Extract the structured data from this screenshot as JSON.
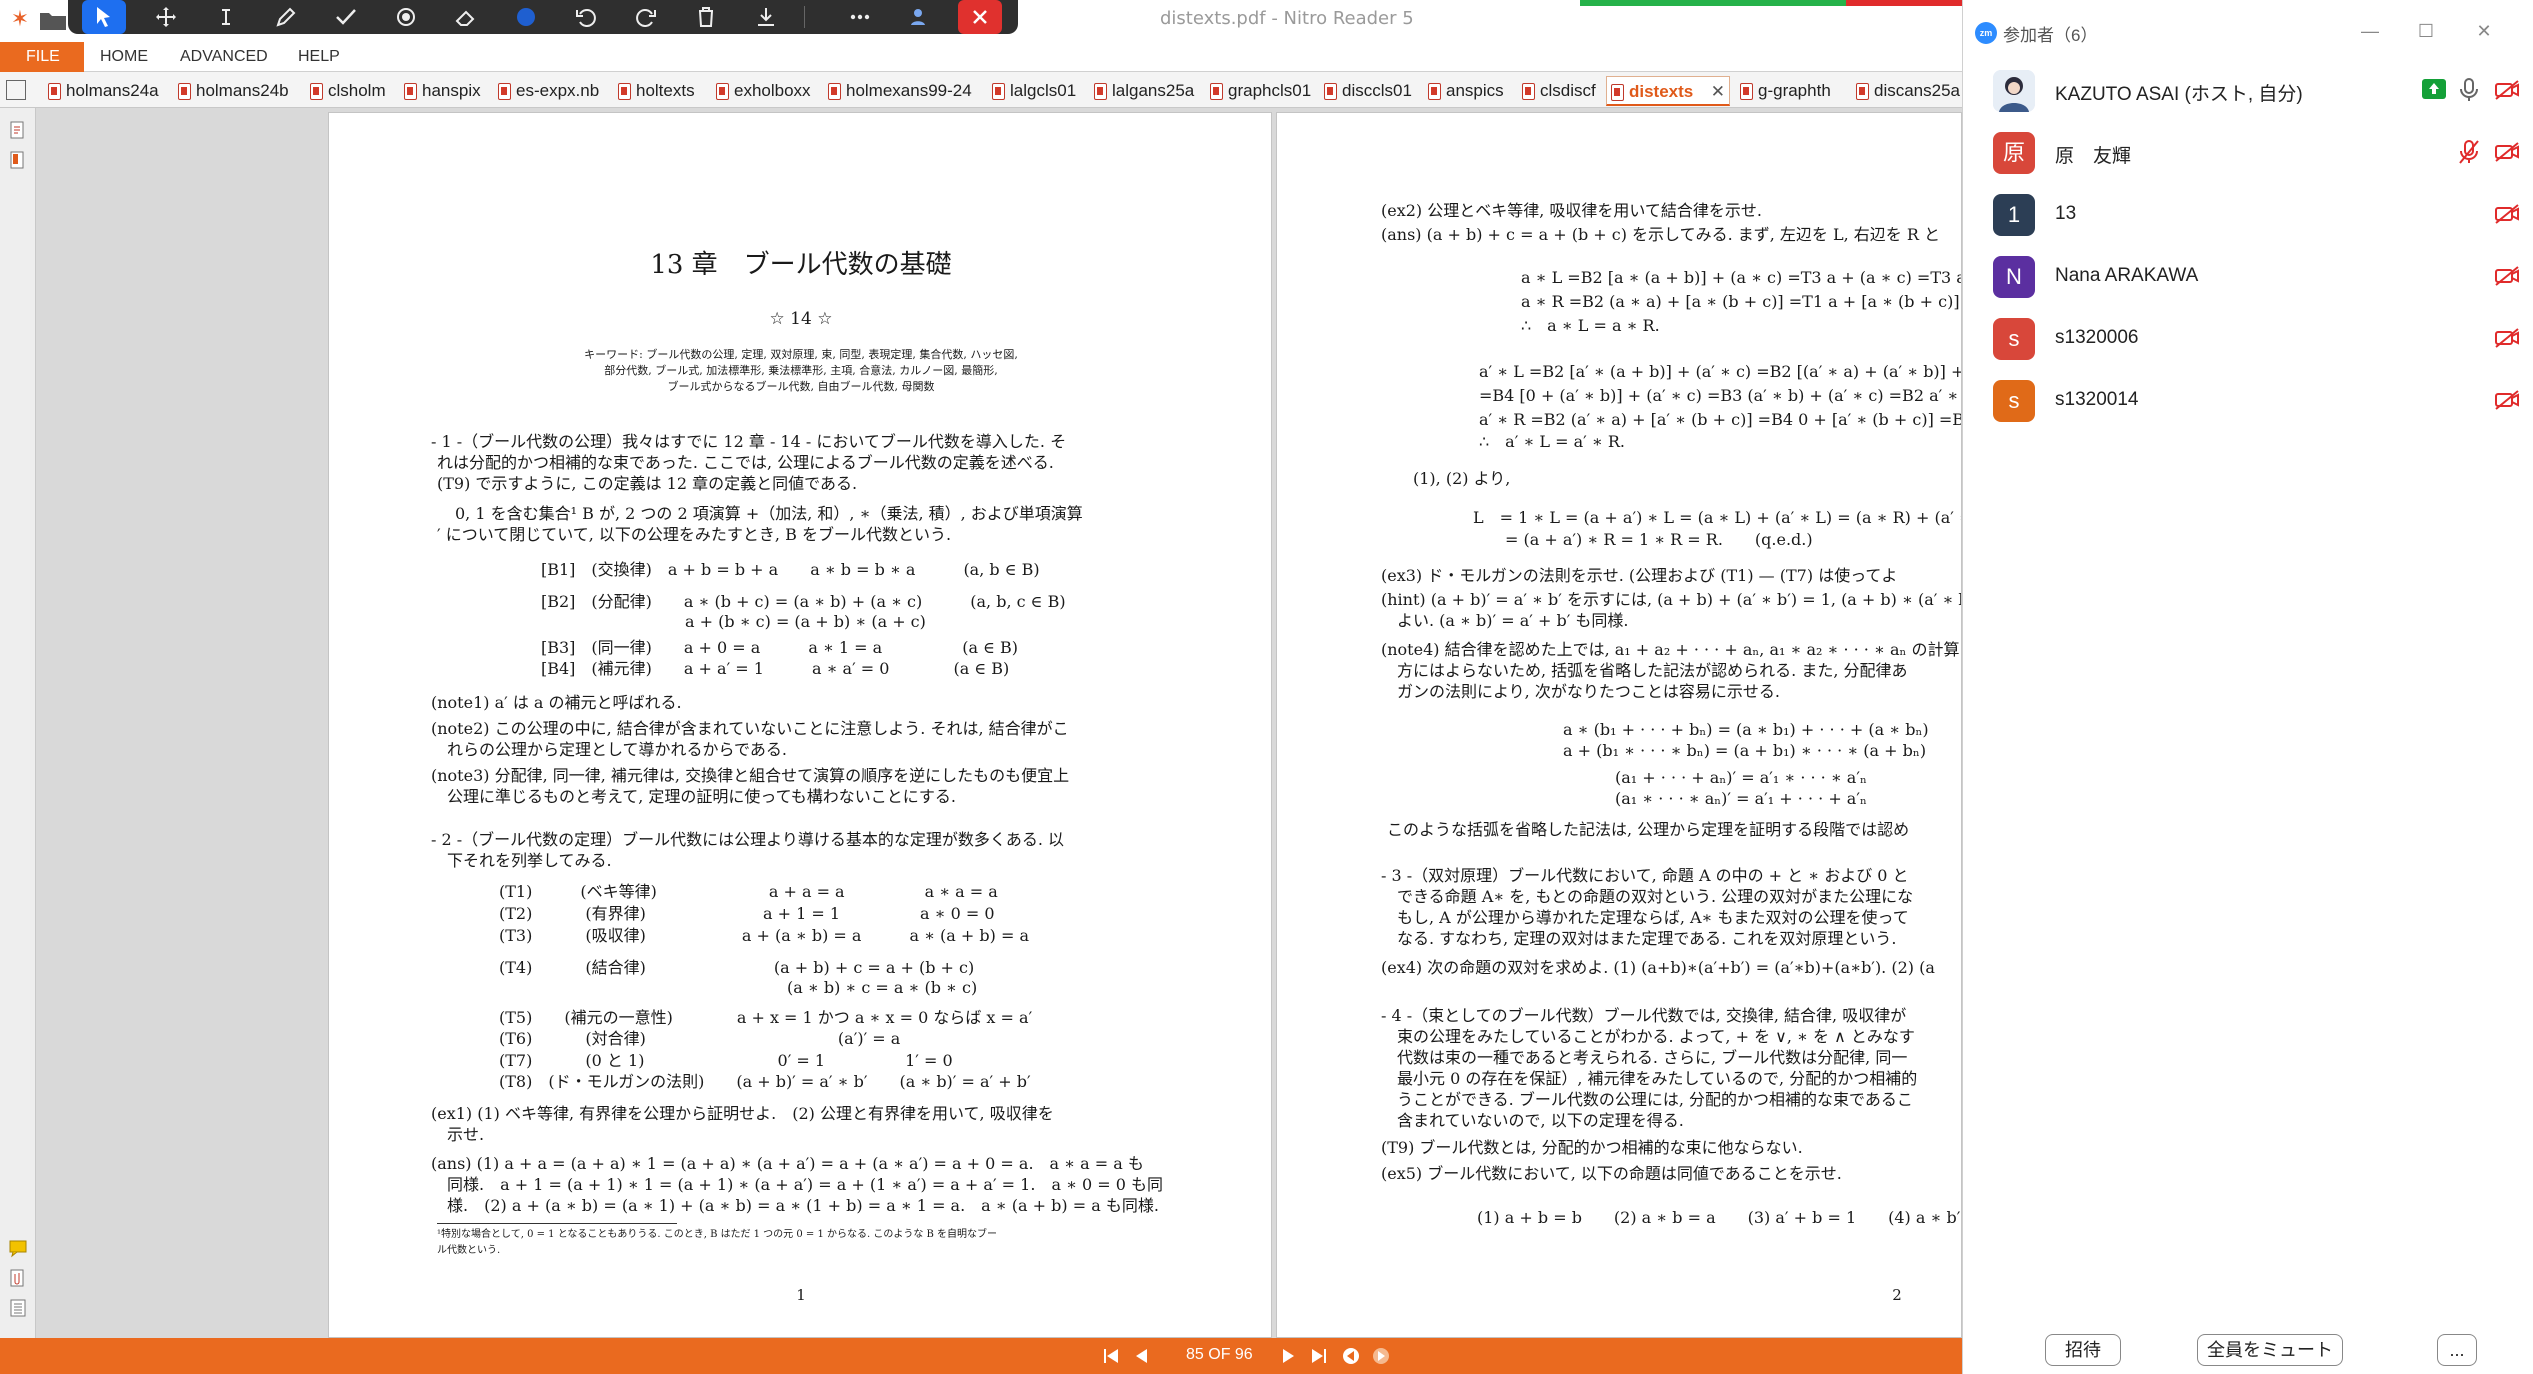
{
  "window": {
    "title": "distexts.pdf - Nitro Reader 5"
  },
  "ribbon": {
    "file": "FILE",
    "home": "HOME",
    "advanced": "ADVANCED",
    "help": "HELP"
  },
  "doc_tabs": [
    "holmans24a",
    "holmans24b",
    "clsholm",
    "hanspix",
    "es-expx.nb",
    "holtexts",
    "exholboxx",
    "holmexans99-24",
    "lalgcls01",
    "lalgans25a",
    "graphcls01",
    "disccls01",
    "anspics",
    "clsdiscf",
    "distexts",
    "g-graphth",
    "discans25a"
  ],
  "active_tab": "distexts",
  "tab_close": "✕",
  "page1": {
    "title": "13 章　ブール代数の基礎",
    "subtitle": "☆ 14 ☆",
    "keywords": [
      "キーワード: ブール代数の公理, 定理, 双対原理, 束, 同型, 表現定理, 集合代数, ハッセ図,",
      "部分代数, ブール式, 加法標準形, 乗法標準形, 主項, 合意法, カルノー図, 最簡形,",
      "ブール式からなるブール代数, 自由ブール代数, 母関数"
    ],
    "sec1": [
      "- 1 -（ブール代数の公理）我々はすでに 12 章 - 14 - においてブール代数を導入した. そ",
      "れは分配的かつ相補的な束であった. ここでは, 公理によるブール代数の定義を述べる.",
      "(T9) で示すように, この定義は 12 章の定義と同値である."
    ],
    "def": [
      "0, 1 を含む集合¹ B が, 2 つの 2 項演算 +（加法, 和）, ∗（乗法, 積）, および単項演算",
      "′ について閉じていて, 以下の公理をみたすとき, B をブール代数という."
    ],
    "axioms": [
      "[B1]　(交換律)　a + b = b + a　　a ∗ b = b ∗ a　　　(a, b ∈ B)",
      "[B2]　(分配律)　　a ∗ (b + c) = (a ∗ b) + (a ∗ c)　　　(a, b, c ∈ B)",
      "　　　　　　　　　a + (b ∗ c) = (a + b) ∗ (a + c)",
      "[B3]　(同一律)　　a + 0 = a　　　a ∗ 1 = a　　　　　(a ∈ B)",
      "[B4]　(補元律)　　a + a′ = 1　　　a ∗ a′ = 0　　　　(a ∈ B)"
    ],
    "notes": [
      "(note1)  a′ は a の補元と呼ばれる.",
      "(note2)  この公理の中に, 結合律が含まれていないことに注意しよう. それは, 結合律がこ",
      "　れらの公理から定理として導かれるからである.",
      "(note3)  分配律, 同一律, 補元律は, 交換律と組合せて演算の順序を逆にしたものも便宜上",
      "　公理に準じるものと考えて, 定理の証明に使っても構わないことにする."
    ],
    "sec2": [
      "- 2 -（ブール代数の定理）ブール代数には公理より導ける基本的な定理が数多くある. 以",
      "　下それを列挙してみる."
    ],
    "theorems": [
      "(T1)　　　(ベキ等律)　　　　　　　a + a = a　　　　　a ∗ a = a",
      "(T2)　　　 (有界律)　　　　　　　 a + 1 = 1　　　　　a ∗ 0 = 0",
      "(T3)　　　 (吸収律)　　　　　　a + (a ∗ b) = a　　　a ∗ (a + b) = a",
      "(T4)　　　 (結合律)　　　　　　　　(a + b) + c = a + (b + c)",
      "　　　　　　　　　　　　　　　　　　(a ∗ b) ∗ c = a ∗ (b ∗ c)",
      "(T5)　　(補元の一意性)　　　　a + x = 1 かつ a ∗ x = 0 ならば x = a′",
      "(T6)　　　 (対合律)　　　　　　　　　　　　(a′)′ = a",
      "(T7)　　　 (0 と 1)　　　　　　　　 0′ = 1　　　　　1′ = 0",
      "(T8)　(ド・モルガンの法則)　　(a + b)′ = a′ ∗ b′　　(a ∗ b)′ = a′ + b′"
    ],
    "ex1": [
      "(ex1)  (1) ベキ等律, 有界律を公理から証明せよ.　(2) 公理と有界律を用いて, 吸収律を",
      "　示せ.",
      "(ans)  (1) a + a = (a + a) ∗ 1 = (a + a) ∗ (a + a′) = a + (a ∗ a′) = a + 0 = a.　a ∗ a = a も",
      "　同様.　a + 1 = (a + 1) ∗ 1 = (a + 1) ∗ (a + a′) = a + (1 ∗ a′) = a + a′ = 1.　a ∗ 0 = 0 も同",
      "　様.　(2) a + (a ∗ b) = (a ∗ 1) + (a ∗ b) = a ∗ (1 + b) = a ∗ 1 = a.　a ∗ (a + b) = a も同様."
    ],
    "footnote": [
      "¹特別な場合として, 0 = 1 となることもありうる. このとき, B はただ 1 つの元 0 = 1 からなる. このような B を自明なブー",
      "ル代数という."
    ],
    "page_number": "1"
  },
  "page2": {
    "lines": [
      "(ex2)  公理とベキ等律, 吸収律を用いて結合律を示せ.",
      "(ans)  (a + b) + c = a + (b + c) を示してみる. まず, 左辺を L, 右辺を R と",
      "a ∗ L =B2 [a ∗ (a + b)] + (a ∗ c) =T3 a + (a ∗ c) =T3 a.",
      "a ∗ R =B2 (a ∗ a) + [a ∗ (b + c)] =T1 a + [a ∗ (b + c)] =T3 a.",
      "∴　a ∗ L = a ∗ R.",
      "a′ ∗ L =B2 [a′ ∗ (a + b)] + (a′ ∗ c) =B2 [(a′ ∗ a) + (a′ ∗ b)] + (a′ ∗ c)",
      "=B4 [0 + (a′ ∗ b)] + (a′ ∗ c) =B3 (a′ ∗ b) + (a′ ∗ c) =B2 a′ ∗ (b + c).",
      "a′ ∗ R =B2 (a′ ∗ a) + [a′ ∗ (b + c)] =B4 0 + [a′ ∗ (b + c)] =B3 a′ ∗ (b +",
      "∴　a′ ∗ L = a′ ∗ R.",
      "(1), (2) より,",
      "L　= 1 ∗ L = (a + a′) ∗ L = (a ∗ L) + (a′ ∗ L) = (a ∗ R) + (a′ ∗",
      "　　= (a + a′) ∗ R = 1 ∗ R = R.　　(q.e.d.)",
      "(ex3)  ド・モルガンの法則を示せ. (公理および (T1) — (T7) は使ってよ",
      "(hint)  (a + b)′ = a′ ∗ b′ を示すには, (a + b) + (a′ ∗ b′) = 1, (a + b) ∗ (a′ ∗ b′",
      "　よい. (a ∗ b)′ = a′ + b′ も同様.",
      "(note4)  結合律を認めた上では, a₁ + a₂ + · · · + aₙ,  a₁ ∗ a₂ ∗ · · · ∗ aₙ の計算",
      "　方にはよらないため, 括弧を省略した記法が認められる. また, 分配律あ",
      "　ガンの法則により, 次がなりたつことは容易に示せる.",
      "a ∗ (b₁ + · · · + bₙ) = (a ∗ b₁) + · · · + (a ∗ bₙ)",
      "a + (b₁ ∗ · · · ∗ bₙ) = (a + b₁) ∗ · · · ∗ (a + bₙ)",
      "(a₁ + · · · + aₙ)′ = a′₁ ∗ · · · ∗ a′ₙ",
      "(a₁ ∗ · · · ∗ aₙ)′ = a′₁ + · · · + a′ₙ",
      "このような括弧を省略した記法は, 公理から定理を証明する段階では認め",
      "- 3 -（双対原理）ブール代数において, 命題 A の中の + と ∗ および 0 と",
      "　できる命題 A∗ を, もとの命題の双対という. 公理の双対がまた公理にな",
      "　もし, A が公理から導かれた定理ならば, A∗ もまた双対の公理を使って",
      "　なる. すなわち, 定理の双対はまた定理である. これを双対原理という.",
      "(ex4)  次の命題の双対を求めよ. (1) (a+b)∗(a′+b′) = (a′∗b)+(a∗b′). (2) (a",
      "- 4 -（束としてのブール代数）ブール代数では, 交換律, 結合律, 吸収律が",
      "　束の公理をみたしていることがわかる. よって, + を ∨, ∗ を ∧ とみなす",
      "　代数は束の一種であると考えられる. さらに, ブール代数は分配律, 同一",
      "　最小元 0 の存在を保証）, 補元律をみたしているので, 分配的かつ相補的",
      "　うことができる. ブール代数の公理には, 分配的かつ相補的な束であるこ",
      "　含まれていないので, 以下の定理を得る.",
      "(T9)  ブール代数とは, 分配的かつ相補的な束に他ならない.",
      "(ex5)  ブール代数において, 以下の命題は同値であることを示せ.",
      "(1) a + b = b　　(2) a ∗ b = a　　(3) a′ + b = 1　　(4) a ∗ b′"
    ],
    "page_number": "2"
  },
  "nav": {
    "page_indicator": "85 OF 96"
  },
  "zoom": {
    "title": "参加者（6）",
    "logo": "zm",
    "participants": [
      {
        "name": "KAZUTO ASAI (ホスト, 自分)",
        "avatar_text": "",
        "color": "#9cb6cc",
        "mic": "on",
        "share": true
      },
      {
        "name": "原　友輝",
        "avatar_text": "原",
        "color": "#d8473a",
        "mic": "off",
        "share": false
      },
      {
        "name": "13",
        "avatar_text": "1",
        "color": "#2c3e55",
        "mic": "none",
        "share": false
      },
      {
        "name": "Nana ARAKAWA",
        "avatar_text": "N",
        "color": "#5b2fa0",
        "mic": "none",
        "share": false
      },
      {
        "name": "s1320006",
        "avatar_text": "s",
        "color": "#d8473a",
        "mic": "none",
        "share": false
      },
      {
        "name": "s1320014",
        "avatar_text": "s",
        "color": "#e06a18",
        "mic": "none",
        "share": false
      }
    ],
    "invite": "招待",
    "mute_all": "全員をミュート",
    "more": "..."
  }
}
